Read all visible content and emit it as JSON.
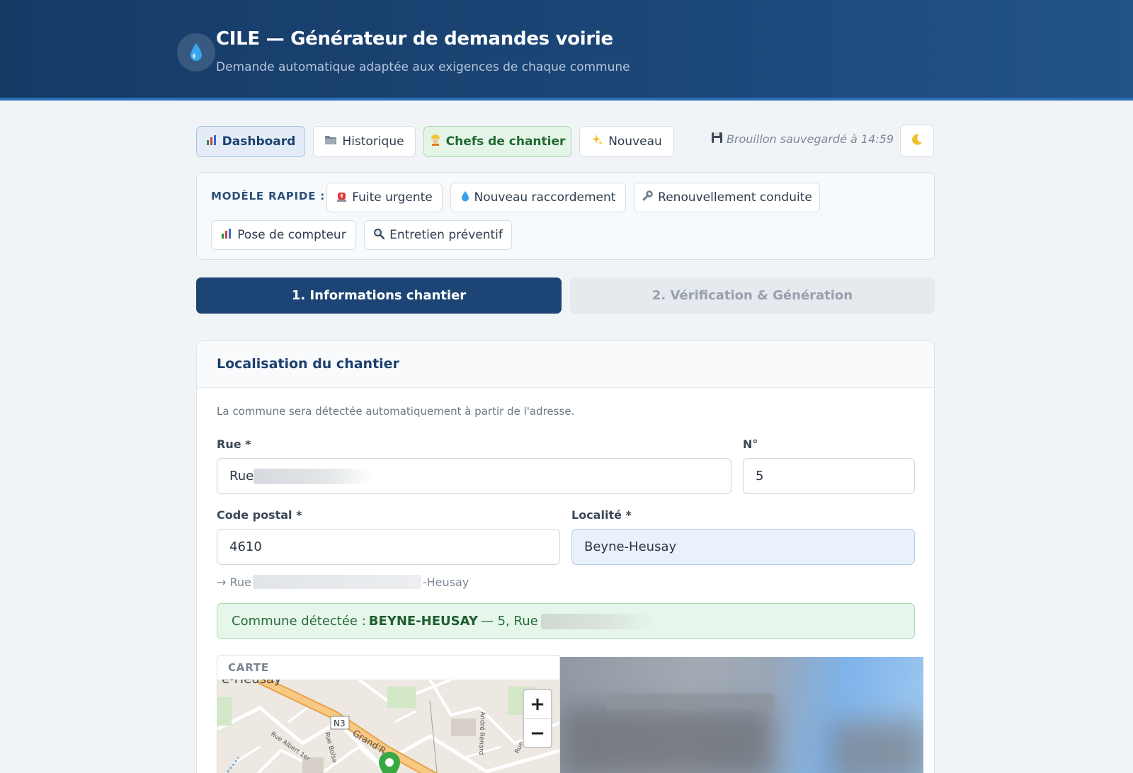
{
  "header": {
    "title": "CILE — Générateur de demandes voirie",
    "subtitle": "Demande automatique adaptée aux exigences de chaque commune"
  },
  "nav": {
    "dashboard": "Dashboard",
    "historique": "Historique",
    "chefs": "Chefs de chantier",
    "nouveau": "Nouveau",
    "draft_status": "Brouillon sauvegardé à 14:59"
  },
  "quick_templates": {
    "label": "MODÈLE RAPIDE :",
    "items": [
      "Fuite urgente",
      "Nouveau raccordement",
      "Renouvellement conduite",
      "Pose de compteur",
      "Entretien préventif"
    ]
  },
  "steps": [
    "1. Informations chantier",
    "2. Vérification & Génération"
  ],
  "location": {
    "title": "Localisation du chantier",
    "hint": "La commune sera détectée automatiquement à partir de l'adresse.",
    "rue_label": "Rue *",
    "rue_value": "Rue",
    "numero_label": "N°",
    "numero_value": "5",
    "cp_label": "Code postal *",
    "cp_value": "4610",
    "localite_label": "Localité *",
    "localite_value": "Beyne-Heusay",
    "preview_prefix": "→ Rue",
    "preview_suffix": "-Heusay",
    "detected_prefix": "Commune détectée :",
    "detected_commune": "BEYNE-HEUSAY",
    "detected_suffix": "— 5, Rue",
    "map_caption": "CARTE"
  },
  "map": {
    "labels": [
      "e-Heusay",
      "N3",
      "Grand'R",
      "Rue Albert 1er",
      "Rue Bolsa",
      "André Renard",
      "Rue"
    ],
    "zoom_in": "+",
    "zoom_out": "−"
  },
  "colors": {
    "header": "#1b4677",
    "accent": "#1c4575",
    "success": "#2a6c3b"
  }
}
